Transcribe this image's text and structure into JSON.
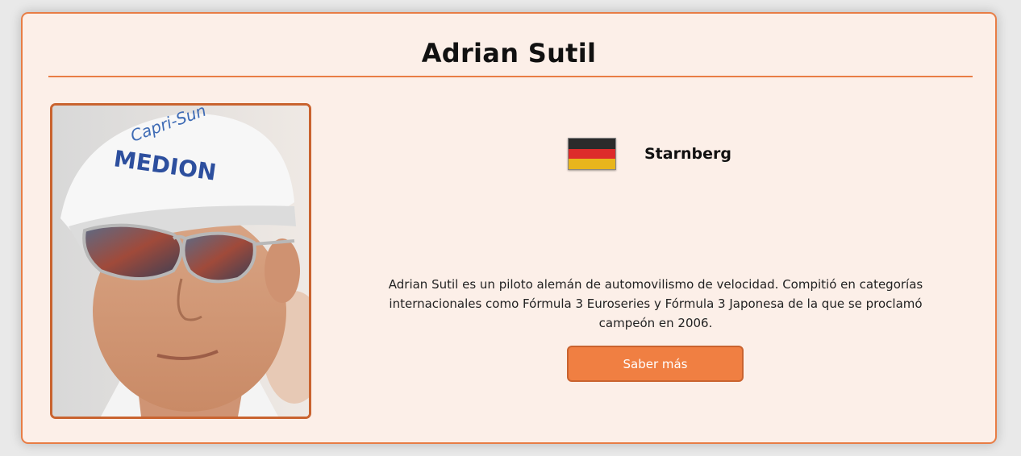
{
  "driver": {
    "name": "Adrian Sutil",
    "photo_icon": "driver-portrait-icon",
    "cap_text_1": "Capri-Sun",
    "cap_text_2": "MEDION"
  },
  "origin": {
    "flag_icon": "germany-flag-icon",
    "flag_colors": [
      "#2b2b2b",
      "#dd2b2b",
      "#e8b51c"
    ],
    "city": "Starnberg"
  },
  "description": "Adrian Sutil es un piloto alemán de automovilismo de velocidad. Compitió en categorías internacionales como Fórmula 3 Euroseries y Fórmula 3 Japonesa de la que se proclamó campeón en 2006.",
  "actions": {
    "more_label": "Saber más"
  },
  "theme": {
    "accent": "#e87d45",
    "card_bg": "#fcefe8",
    "button_bg": "#f07f42"
  }
}
